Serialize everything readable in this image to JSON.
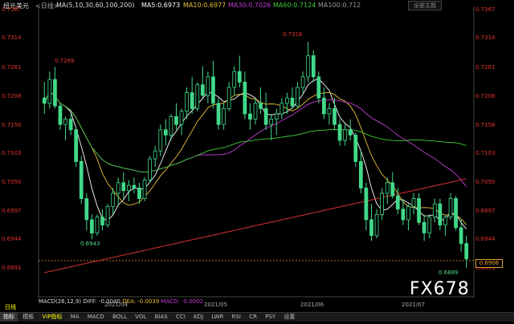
{
  "header": {
    "symbol": "纽元美元",
    "period_tag": "<日线>",
    "ma_label": "MA(5,10,30,60,100,200)",
    "ma5": "MA5:0.6973",
    "ma10": "MA10:0.6977",
    "ma30": "MA30:0.7026",
    "ma60": "MA60:0.7124",
    "ma100": "MA100:0.712",
    "fullscreen_label": "全部主题"
  },
  "colors": {
    "up": "#42d98a",
    "down": "#42d98a",
    "ma5": "#ffffff",
    "ma10": "#e8c238",
    "ma30": "#c43ad8",
    "ma60": "#3fcc3a",
    "ma100": "#999999",
    "ma200": "#d8342c",
    "price_text": "#e6322c"
  },
  "price_axis": {
    "labels": [
      "0.7367",
      "0.7314",
      "0.7261",
      "0.7208",
      "0.7156",
      "0.7103",
      "0.7050",
      "0.6997",
      "0.6944",
      "0.6891"
    ],
    "current_price": "0.6906"
  },
  "annotations": {
    "high1": "0.7269",
    "high2": "0.7316",
    "low1": "0.6943",
    "low2": "0.6889"
  },
  "time_axis": [
    "2021/04",
    "2021/05",
    "2021/06",
    "2021/07"
  ],
  "macd": {
    "label": "MACD(26,12,9)",
    "diff": "DIFF: -0.0040",
    "dea": "DEA: -0.0039",
    "macd": "MACD: -0.0002"
  },
  "period_label": "日线",
  "bottom_tabs": [
    "指标",
    "模板",
    "VIP指标",
    "MA",
    "MACD",
    "BOLL",
    "VOL",
    "BIAS",
    "CCI",
    "KDJ",
    "LWR",
    "RSI",
    "CR",
    "PSY",
    "设置"
  ],
  "watermark": "FX678",
  "chart_data": {
    "type": "candlestick",
    "ylim": [
      0.688,
      0.738
    ],
    "candles": [
      [
        0.721,
        0.724,
        0.718,
        0.72
      ],
      [
        0.72,
        0.726,
        0.719,
        0.7245
      ],
      [
        0.7245,
        0.7269,
        0.719,
        0.7195
      ],
      [
        0.7195,
        0.72,
        0.715,
        0.716
      ],
      [
        0.716,
        0.7175,
        0.713,
        0.717
      ],
      [
        0.717,
        0.718,
        0.714,
        0.715
      ],
      [
        0.715,
        0.7155,
        0.708,
        0.709
      ],
      [
        0.709,
        0.71,
        0.701,
        0.702
      ],
      [
        0.702,
        0.703,
        0.696,
        0.698
      ],
      [
        0.698,
        0.699,
        0.6943,
        0.6955
      ],
      [
        0.6955,
        0.699,
        0.695,
        0.6985
      ],
      [
        0.6985,
        0.7,
        0.696,
        0.697
      ],
      [
        0.697,
        0.701,
        0.6965,
        0.7005
      ],
      [
        0.7005,
        0.704,
        0.699,
        0.703
      ],
      [
        0.703,
        0.706,
        0.701,
        0.705
      ],
      [
        0.705,
        0.707,
        0.702,
        0.7035
      ],
      [
        0.7035,
        0.7055,
        0.7015,
        0.7045
      ],
      [
        0.7045,
        0.706,
        0.703,
        0.704
      ],
      [
        0.704,
        0.705,
        0.701,
        0.702
      ],
      [
        0.702,
        0.706,
        0.7015,
        0.7055
      ],
      [
        0.7055,
        0.71,
        0.705,
        0.7095
      ],
      [
        0.7095,
        0.712,
        0.708,
        0.711
      ],
      [
        0.711,
        0.716,
        0.71,
        0.715
      ],
      [
        0.715,
        0.717,
        0.712,
        0.714
      ],
      [
        0.714,
        0.718,
        0.713,
        0.7175
      ],
      [
        0.7175,
        0.72,
        0.715,
        0.716
      ],
      [
        0.716,
        0.719,
        0.714,
        0.7185
      ],
      [
        0.7185,
        0.723,
        0.717,
        0.722
      ],
      [
        0.722,
        0.725,
        0.718,
        0.719
      ],
      [
        0.719,
        0.724,
        0.7185,
        0.7235
      ],
      [
        0.7235,
        0.727,
        0.721,
        0.7215
      ],
      [
        0.7215,
        0.726,
        0.72,
        0.725
      ],
      [
        0.725,
        0.728,
        0.719,
        0.72
      ],
      [
        0.72,
        0.721,
        0.715,
        0.716
      ],
      [
        0.716,
        0.72,
        0.715,
        0.719
      ],
      [
        0.719,
        0.724,
        0.7185,
        0.723
      ],
      [
        0.723,
        0.727,
        0.7215,
        0.726
      ],
      [
        0.726,
        0.729,
        0.723,
        0.724
      ],
      [
        0.724,
        0.726,
        0.717,
        0.718
      ],
      [
        0.718,
        0.72,
        0.715,
        0.717
      ],
      [
        0.717,
        0.721,
        0.716,
        0.72
      ],
      [
        0.72,
        0.723,
        0.718,
        0.719
      ],
      [
        0.719,
        0.722,
        0.715,
        0.716
      ],
      [
        0.716,
        0.718,
        0.713,
        0.717
      ],
      [
        0.717,
        0.719,
        0.714,
        0.718
      ],
      [
        0.718,
        0.721,
        0.717,
        0.72
      ],
      [
        0.72,
        0.722,
        0.718,
        0.721
      ],
      [
        0.721,
        0.723,
        0.719,
        0.7195
      ],
      [
        0.7195,
        0.724,
        0.719,
        0.723
      ],
      [
        0.723,
        0.726,
        0.722,
        0.725
      ],
      [
        0.725,
        0.7316,
        0.724,
        0.729
      ],
      [
        0.729,
        0.73,
        0.724,
        0.725
      ],
      [
        0.725,
        0.726,
        0.72,
        0.721
      ],
      [
        0.721,
        0.723,
        0.717,
        0.718
      ],
      [
        0.718,
        0.72,
        0.716,
        0.719
      ],
      [
        0.719,
        0.721,
        0.715,
        0.716
      ],
      [
        0.716,
        0.717,
        0.712,
        0.713
      ],
      [
        0.713,
        0.716,
        0.712,
        0.715
      ],
      [
        0.715,
        0.717,
        0.713,
        0.714
      ],
      [
        0.714,
        0.7145,
        0.708,
        0.709
      ],
      [
        0.709,
        0.711,
        0.703,
        0.704
      ],
      [
        0.704,
        0.705,
        0.696,
        0.698
      ],
      [
        0.698,
        0.701,
        0.694,
        0.695
      ],
      [
        0.695,
        0.7,
        0.6945,
        0.699
      ],
      [
        0.699,
        0.704,
        0.698,
        0.703
      ],
      [
        0.703,
        0.706,
        0.701,
        0.705
      ],
      [
        0.705,
        0.707,
        0.702,
        0.7025
      ],
      [
        0.7025,
        0.704,
        0.699,
        0.7
      ],
      [
        0.7,
        0.702,
        0.697,
        0.698
      ],
      [
        0.698,
        0.701,
        0.696,
        0.7005
      ],
      [
        0.7005,
        0.703,
        0.699,
        0.702
      ],
      [
        0.702,
        0.703,
        0.697,
        0.6975
      ],
      [
        0.6975,
        0.699,
        0.694,
        0.6955
      ],
      [
        0.6955,
        0.699,
        0.6945,
        0.6985
      ],
      [
        0.6985,
        0.702,
        0.6975,
        0.701
      ],
      [
        0.701,
        0.702,
        0.696,
        0.697
      ],
      [
        0.697,
        0.699,
        0.695,
        0.6985
      ],
      [
        0.6985,
        0.703,
        0.698,
        0.702
      ],
      [
        0.702,
        0.7025,
        0.696,
        0.6965
      ],
      [
        0.6965,
        0.698,
        0.692,
        0.6935
      ],
      [
        0.6935,
        0.695,
        0.6889,
        0.6906
      ]
    ]
  }
}
